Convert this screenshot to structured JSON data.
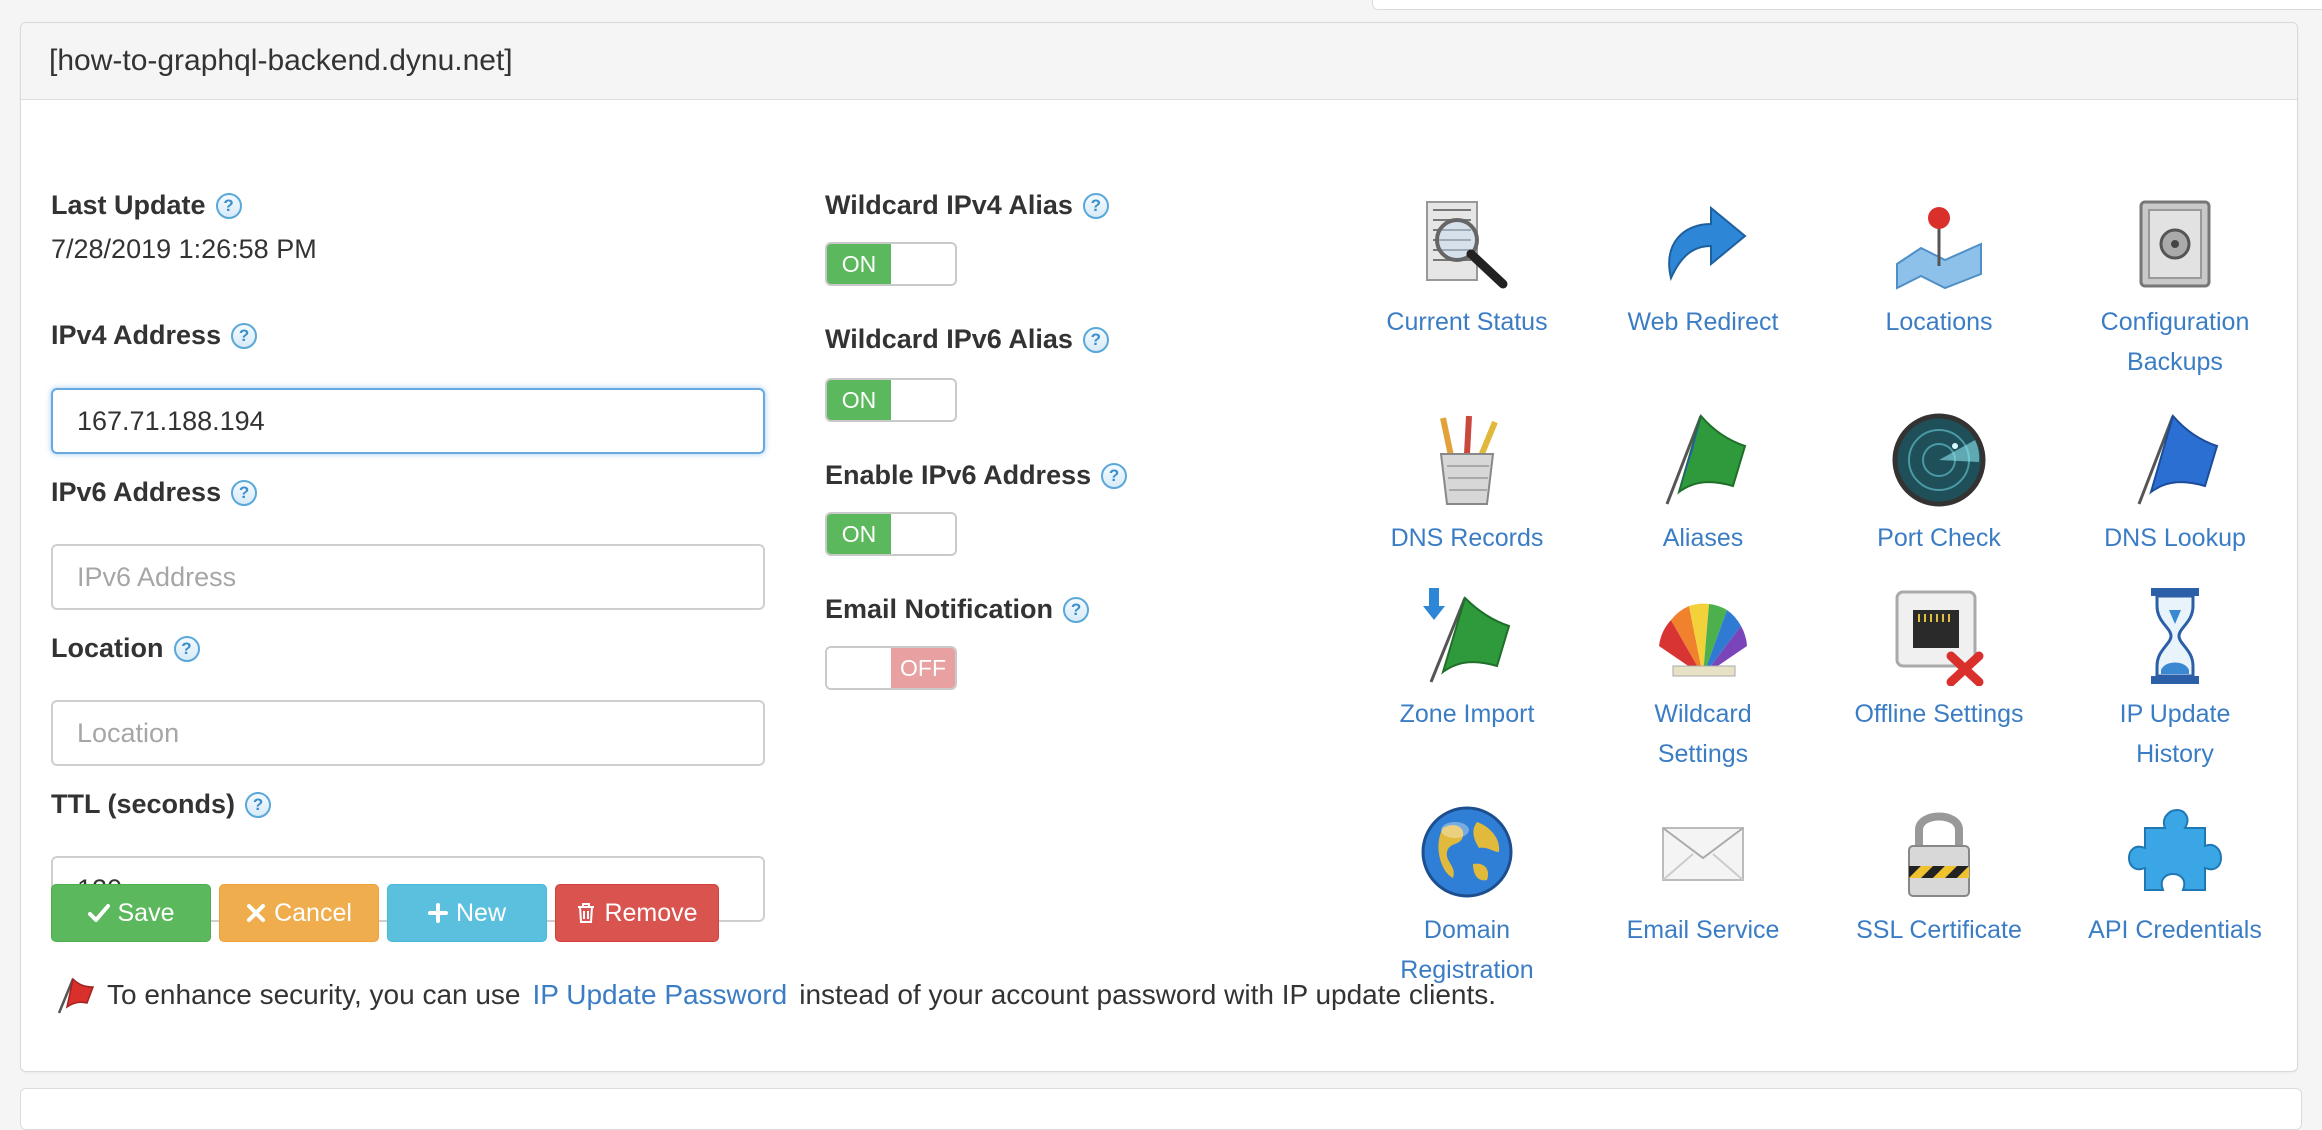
{
  "panel": {
    "title": "[how-to-graphql-backend.dynu.net]"
  },
  "form": {
    "last_update_label": "Last Update",
    "last_update_value": "7/28/2019 1:26:58 PM",
    "ipv4_label": "IPv4 Address",
    "ipv4_value": "167.71.188.194",
    "ipv6_label": "IPv6 Address",
    "ipv6_placeholder": "IPv6 Address",
    "location_label": "Location",
    "location_placeholder": "Location",
    "ttl_label": "TTL (seconds)",
    "ttl_value": "120",
    "help_glyph": "?"
  },
  "buttons": {
    "save": "Save",
    "cancel": "Cancel",
    "new": "New",
    "remove": "Remove"
  },
  "toggles": [
    {
      "label": "Wildcard IPv4 Alias",
      "state": "ON"
    },
    {
      "label": "Wildcard IPv6 Alias",
      "state": "ON"
    },
    {
      "label": "Enable IPv6 Address",
      "state": "ON"
    },
    {
      "label": "Email Notification",
      "state": "OFF"
    }
  ],
  "tiles": [
    {
      "label": "Current Status",
      "icon": "magnifier-icon"
    },
    {
      "label": "Web Redirect",
      "icon": "redirect-arrow-icon"
    },
    {
      "label": "Locations",
      "icon": "map-pin-icon"
    },
    {
      "label": "Configuration Backups",
      "icon": "safe-icon"
    },
    {
      "label": "DNS Records",
      "icon": "pencil-cup-icon"
    },
    {
      "label": "Aliases",
      "icon": "flag-icon"
    },
    {
      "label": "Port Check",
      "icon": "radar-icon"
    },
    {
      "label": "DNS Lookup",
      "icon": "blue-flag-icon"
    },
    {
      "label": "Zone Import",
      "icon": "flag-import-icon"
    },
    {
      "label": "Wildcard Settings",
      "icon": "color-fan-icon"
    },
    {
      "label": "Offline Settings",
      "icon": "network-port-icon"
    },
    {
      "label": "IP Update History",
      "icon": "hourglass-icon"
    },
    {
      "label": "Domain Registration",
      "icon": "globe-icon"
    },
    {
      "label": "Email Service",
      "icon": "envelope-icon"
    },
    {
      "label": "SSL Certificate",
      "icon": "padlock-icon"
    },
    {
      "label": "API Credentials",
      "icon": "puzzle-icon"
    }
  ],
  "notice": {
    "before": "To enhance security, you can use",
    "link": "IP Update Password",
    "after": "instead of your account password with IP update clients."
  },
  "colors": {
    "link": "#3b7dc4",
    "save": "#5cb85c",
    "cancel": "#f0ad4e",
    "new": "#5bc0de",
    "remove": "#d9534f",
    "toggle_on": "#5cb85c",
    "toggle_off": "#e8a0a0"
  }
}
